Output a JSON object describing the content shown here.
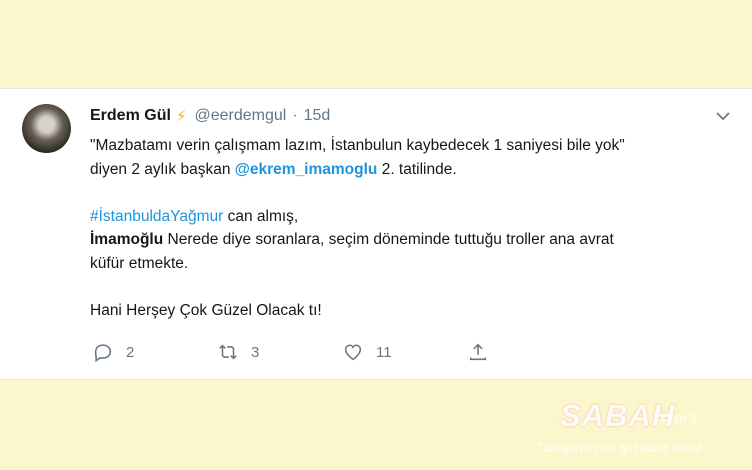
{
  "tweet": {
    "author_name": "Erdem Gül",
    "handle": "@eerdemgul",
    "separator": "·",
    "time": "15d",
    "lines": {
      "l1": "\"Mazbatamı verin çalışmam lazım, İstanbulun kaybedecek 1 saniyesi bile yok\"",
      "l2_pre": "diyen 2 aylık başkan",
      "l2_mention": "@ekrem_imamoglu",
      "l2_post": "2. tatilinde.",
      "l3_hashtag": "#İstanbuldaYağmur",
      "l3_post": "can almış,",
      "l4_bold": "İmamoğlu",
      "l4_post": "Nerede diye soranlara, seçim döneminde tuttuğu troller ana avrat",
      "l5": "küfür etmekte.",
      "l6": "Hani Herşey Çok Güzel Olacak tı!"
    },
    "actions": {
      "reply_count": "2",
      "retweet_count": "3",
      "like_count": "11"
    }
  },
  "watermark": {
    "brand": "SABAH",
    "domain": ".com.tr",
    "tagline": "Türkiye'nin en iyi haber sitesi"
  },
  "icons": {
    "verified_bolt": "lightning-bolt-icon",
    "menu": "chevron-down-icon",
    "reply": "speech-bubble-icon",
    "retweet": "retweet-arrows-icon",
    "like": "heart-icon",
    "share": "share-upload-icon"
  },
  "colors": {
    "background": "#fcf6cc",
    "link": "#1b95e0",
    "muted": "#657786",
    "bolt": "#f5b400"
  }
}
